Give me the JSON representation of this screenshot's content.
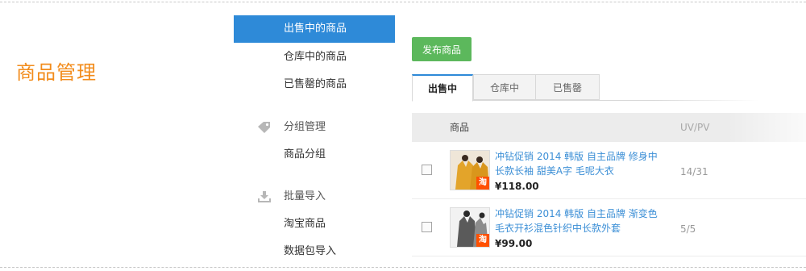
{
  "page_title": "商品管理",
  "sidebar": {
    "items": [
      {
        "label": "出售中的商品",
        "active": true
      },
      {
        "label": "仓库中的商品",
        "active": false
      },
      {
        "label": "已售罄的商品",
        "active": false
      }
    ],
    "groups": [
      {
        "label": "分组管理",
        "icon": "tag-icon",
        "items": [
          {
            "label": "商品分组"
          }
        ]
      },
      {
        "label": "批量导入",
        "icon": "import-icon",
        "items": [
          {
            "label": "淘宝商品"
          },
          {
            "label": "数据包导入"
          }
        ]
      }
    ]
  },
  "toolbar": {
    "publish_label": "发布商品"
  },
  "tabs": [
    {
      "label": "出售中",
      "active": true
    },
    {
      "label": "仓库中",
      "active": false
    },
    {
      "label": "已售罄",
      "active": false
    }
  ],
  "table": {
    "headers": {
      "product": "商品",
      "uvpv": "UV/PV"
    },
    "rows": [
      {
        "title": "冲钻促销 2014 韩版 自主品牌 修身中长款长袖 甜美A字 毛呢大衣",
        "price": "¥118.00",
        "uvpv": "14/31",
        "badge": "淘"
      },
      {
        "title": "冲钻促销 2014 韩版 自主品牌 渐变色毛衣开衫混色针织中长款外套",
        "price": "¥99.00",
        "uvpv": "5/5",
        "badge": "淘"
      }
    ]
  },
  "colors": {
    "accent": "#2e8ad8",
    "brand_orange": "#f28c1c",
    "publish_green": "#5cb85c",
    "link": "#3c8fd6",
    "badge": "#ff5000"
  }
}
